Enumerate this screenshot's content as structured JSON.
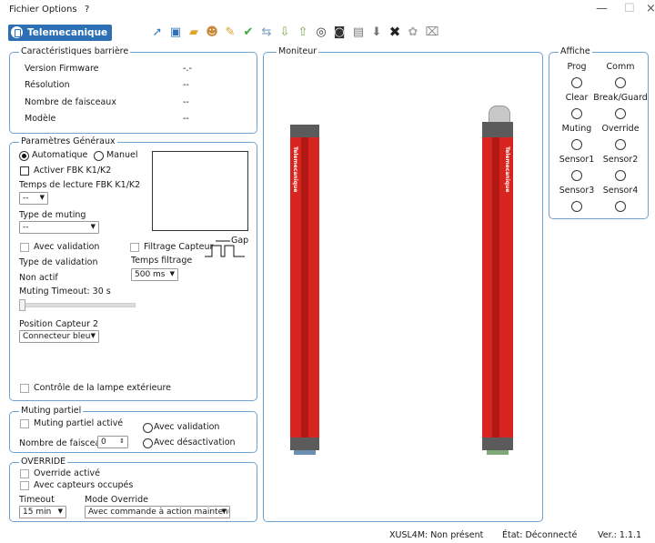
{
  "menu": {
    "file": "Fichier",
    "options": "Options",
    "help": "?"
  },
  "window": {
    "minimize": "—",
    "maximize": "☐",
    "close": "×"
  },
  "brand": {
    "name": "Telemecanique"
  },
  "toolbar": {
    "icons": [
      "upload-icon",
      "save-icon",
      "open-folder-icon",
      "user-icon",
      "edit-icon",
      "check-icon",
      "swap-icon",
      "download-icon",
      "upload-arrow-icon",
      "target-icon",
      "monitor-icon",
      "clipboard-icon",
      "import-icon",
      "delete-icon",
      "settings-icon",
      "disconnect-icon"
    ]
  },
  "barrier": {
    "title": "Caractéristiques barrière",
    "firmware_label": "Version Firmware",
    "firmware_value": "-.-",
    "resolution_label": "Résolution",
    "resolution_value": "--",
    "beams_label": "Nombre de faisceaux",
    "beams_value": "--",
    "model_label": "Modèle",
    "model_value": "--"
  },
  "general": {
    "title": "Paramètres Généraux",
    "auto": "Automatique",
    "manual": "Manuel",
    "fbk_enable": "Activer FBK K1/K2",
    "fbk_time": "Temps de lecture FBK K1/K2",
    "fbk_time_value": "--",
    "muting_type": "Type de muting",
    "muting_type_value": "--",
    "with_validation": "Avec validation",
    "validation_type": "Type de validation",
    "status": "Non actif",
    "muting_timeout": "Muting Timeout: 30 s",
    "sensor_filter": "Filtrage Capteur",
    "gap": "Gap",
    "filter_time": "Temps filtrage",
    "filter_time_value": "500 ms",
    "sensor2_position": "Position Capteur 2",
    "sensor2_value": "Connecteur bleu",
    "lamp_control": "Contrôle de la lampe extérieure"
  },
  "partial": {
    "title": "Muting partiel",
    "enabled": "Muting partiel activé",
    "beams": "Nombre de faisceaux",
    "beams_value": "0",
    "with_validation": "Avec validation",
    "with_deactivation": "Avec désactivation"
  },
  "override": {
    "title": "OVERRIDE",
    "enabled": "Override activé",
    "occupied": "Avec capteurs occupés",
    "timeout": "Timeout",
    "timeout_value": "15 min",
    "mode": "Mode Override",
    "mode_value": "Avec commande à action maintenue"
  },
  "monitor": {
    "title": "Moniteur",
    "brand": "Telemecanique"
  },
  "display": {
    "title": "Affiche",
    "leds": [
      "Prog",
      "Comm",
      "Clear",
      "Break/Guard",
      "Muting",
      "Override",
      "Sensor1",
      "Sensor2",
      "Sensor3",
      "Sensor4"
    ]
  },
  "status": {
    "device": "XUSL4M: Non présent",
    "state": "État: Déconnecté",
    "version": "Ver.: 1.1.1"
  }
}
